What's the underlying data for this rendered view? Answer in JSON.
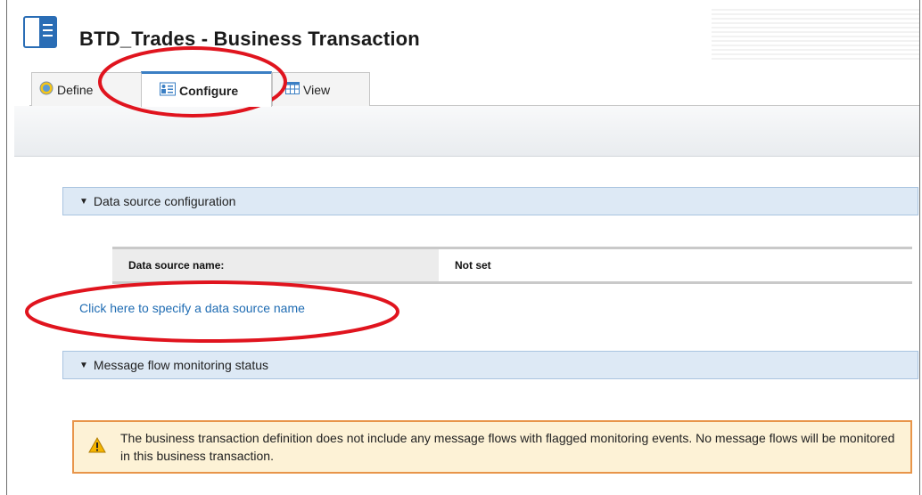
{
  "page": {
    "title": "BTD_Trades - Business Transaction"
  },
  "tabs": [
    {
      "label": "Define",
      "icon": "globe-icon",
      "active": false
    },
    {
      "label": "Configure",
      "icon": "configure-icon",
      "active": true
    },
    {
      "label": "View",
      "icon": "table-icon",
      "active": false
    }
  ],
  "sections": {
    "data_source": {
      "header": "Data source configuration",
      "rows": [
        {
          "label": "Data source name:",
          "value": "Not set"
        }
      ],
      "link": "Click here to specify a data source name"
    },
    "monitoring": {
      "header": "Message flow monitoring status",
      "warning": "The business transaction definition does not include any message flows with flagged monitoring events. No message flows will be monitored in this business transaction."
    }
  },
  "colors": {
    "accent": "#3b7fc4",
    "link": "#1f6cb3",
    "warning_border": "#e8954a",
    "warning_bg": "#fdf2d6",
    "annotation": "#e0141e"
  }
}
